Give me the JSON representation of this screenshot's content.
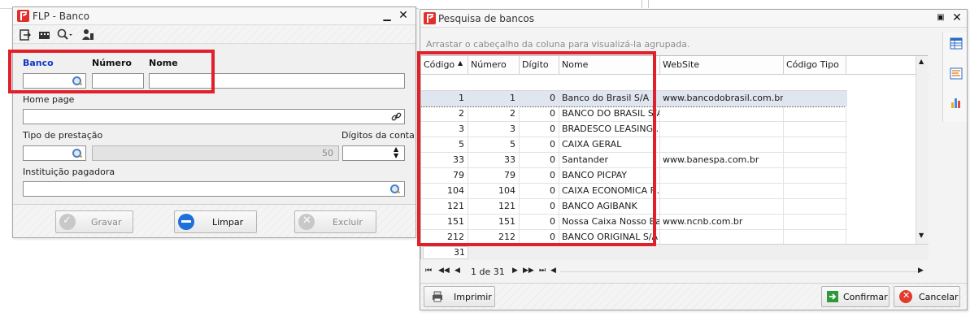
{
  "left_window": {
    "title": "FLP - Banco",
    "labels": {
      "banco": "Banco",
      "numero": "Número",
      "nome": "Nome",
      "home_page": "Home page",
      "tipo_prestacao": "Tipo de prestação",
      "digitos_conta": "Dígitos da conta",
      "instituicao": "Instituição pagadora"
    },
    "values": {
      "prestacao_ro": "50"
    },
    "buttons": {
      "gravar": "Gravar",
      "limpar": "Limpar",
      "excluir": "Excluir"
    }
  },
  "right_window": {
    "title": "Pesquisa de bancos",
    "group_hint": "Arrastar o cabeçalho da coluna para visualizá-la agrupada.",
    "columns": [
      "Código",
      "Número",
      "Dígito",
      "Nome",
      "WebSite",
      "Código Tipo"
    ],
    "rows": [
      {
        "codigo": "1",
        "numero": "1",
        "digito": "0",
        "nome": "Banco do Brasil S/A",
        "website": "www.bancodobrasil.com.br",
        "codigo_tipo": ""
      },
      {
        "codigo": "2",
        "numero": "2",
        "digito": "0",
        "nome": "BANCO DO BRASIL S/A",
        "website": "",
        "codigo_tipo": ""
      },
      {
        "codigo": "3",
        "numero": "3",
        "digito": "0",
        "nome": "BRADESCO LEASING ...",
        "website": "",
        "codigo_tipo": ""
      },
      {
        "codigo": "5",
        "numero": "5",
        "digito": "0",
        "nome": "CAIXA GERAL",
        "website": "",
        "codigo_tipo": ""
      },
      {
        "codigo": "33",
        "numero": "33",
        "digito": "0",
        "nome": "Santander",
        "website": "www.banespa.com.br",
        "codigo_tipo": ""
      },
      {
        "codigo": "79",
        "numero": "79",
        "digito": "0",
        "nome": "BANCO PICPAY",
        "website": "",
        "codigo_tipo": ""
      },
      {
        "codigo": "104",
        "numero": "104",
        "digito": "0",
        "nome": "CAIXA ECONOMICA F...",
        "website": "",
        "codigo_tipo": ""
      },
      {
        "codigo": "121",
        "numero": "121",
        "digito": "0",
        "nome": "BANCO AGIBANK",
        "website": "",
        "codigo_tipo": ""
      },
      {
        "codigo": "151",
        "numero": "151",
        "digito": "0",
        "nome": "Nossa Caixa Nosso Ba...",
        "website": "www.ncnb.com.br",
        "codigo_tipo": ""
      },
      {
        "codigo": "212",
        "numero": "212",
        "digito": "0",
        "nome": "BANCO ORIGINAL S/A",
        "website": "",
        "codigo_tipo": ""
      }
    ],
    "footer_count": "31",
    "pager": "1 de 31",
    "buttons": {
      "imprimir": "Imprimir",
      "confirmar": "Confirmar",
      "cancelar": "Cancelar"
    }
  },
  "colors": {
    "highlight": "#e0202a",
    "selected_row": "#dfe6f0",
    "label_blue": "#1336c8"
  }
}
